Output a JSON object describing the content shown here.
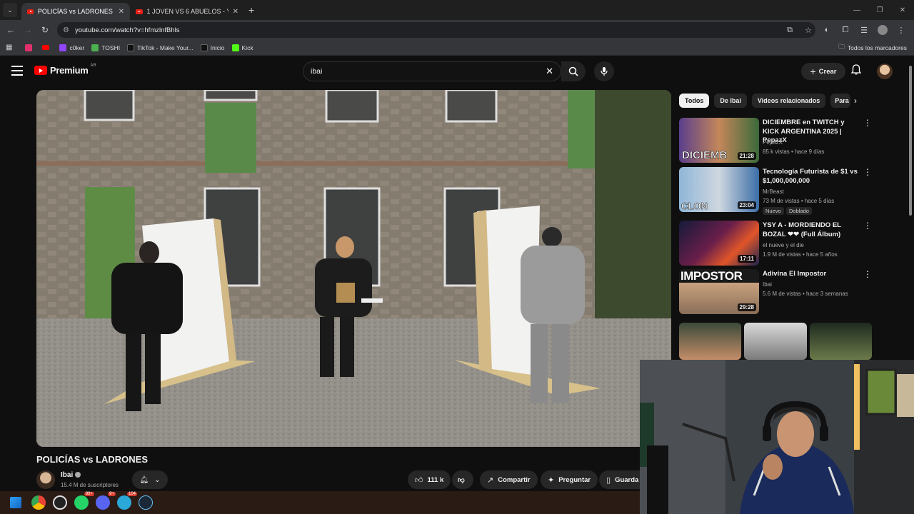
{
  "browser": {
    "tabs": [
      {
        "title": "POLICÍAS vs LADRONES - YouTube",
        "active": true
      },
      {
        "title": "1 JOVEN VS 6 ABUELOS - YouTube",
        "active": false
      }
    ],
    "url": "youtube.com/watch?v=hfmzlnfBhls",
    "bookmarks": [
      {
        "label": "",
        "icon": "instagram-icon",
        "color": "#e1306c"
      },
      {
        "label": "",
        "icon": "youtube-icon",
        "color": "#ff0000"
      },
      {
        "label": "c0ker",
        "icon": "twitch-icon",
        "color": "#9146ff"
      },
      {
        "label": "TOSHI",
        "icon": "toshi-icon",
        "color": "#4caf50"
      },
      {
        "label": "TikTok - Make Your...",
        "icon": "tiktok-icon",
        "color": "#000000"
      },
      {
        "label": "Inicio",
        "icon": "x-icon",
        "color": "#000000"
      },
      {
        "label": "Kick",
        "icon": "kick-icon",
        "color": "#53fc18"
      }
    ],
    "bookmarks_folder": "Todos los marcadores"
  },
  "youtube": {
    "logo_text": "Premium",
    "country_code": "AR",
    "search_value": "ibai",
    "create_label": "Crear"
  },
  "video": {
    "title": "POLICÍAS vs LADRONES",
    "channel": "Ibai",
    "subscribers": "15.4 M de suscriptores",
    "likes": "111 k",
    "share_label": "Compartir",
    "ask_label": "Preguntar",
    "save_label": "Guarda"
  },
  "chips": [
    "Todos",
    "De Ibai",
    "Videos relacionados",
    "Para"
  ],
  "recommendations": [
    {
      "title": "DICIEMBRE en TWITCH y KICK ARGENTINA 2025 | PepazX",
      "channel": "PepazX",
      "meta": "85 k vistas • hace 9 días",
      "duration": "21:28",
      "thumb_text": "DICIEMB",
      "badges": []
    },
    {
      "title": "Tecnología Futurista de $1 vs $1,000,000,000",
      "channel": "MrBeast",
      "meta": "73 M de vistas • hace 5 días",
      "duration": "23:04",
      "thumb_text": "CLON",
      "badges": [
        "Nuevo",
        "Doblado"
      ]
    },
    {
      "title": "YSY A - MORDIENDO EL BOZAL ❤❤ (Full Álbum)",
      "channel": "el nueve y el die",
      "meta": "1.9 M de vistas • hace 5 años",
      "duration": "17:11",
      "thumb_text": "",
      "badges": []
    },
    {
      "title": "Adivina El Impostor",
      "channel": "Ibai",
      "meta": "5.6 M de vistas • hace 3 semanas",
      "duration": "29:28",
      "thumb_text": "IMPOSTOR",
      "badges": []
    }
  ],
  "taskbar": {
    "whatsapp_badge": "99+",
    "discord_badge": "9+",
    "app_badge": "104"
  }
}
